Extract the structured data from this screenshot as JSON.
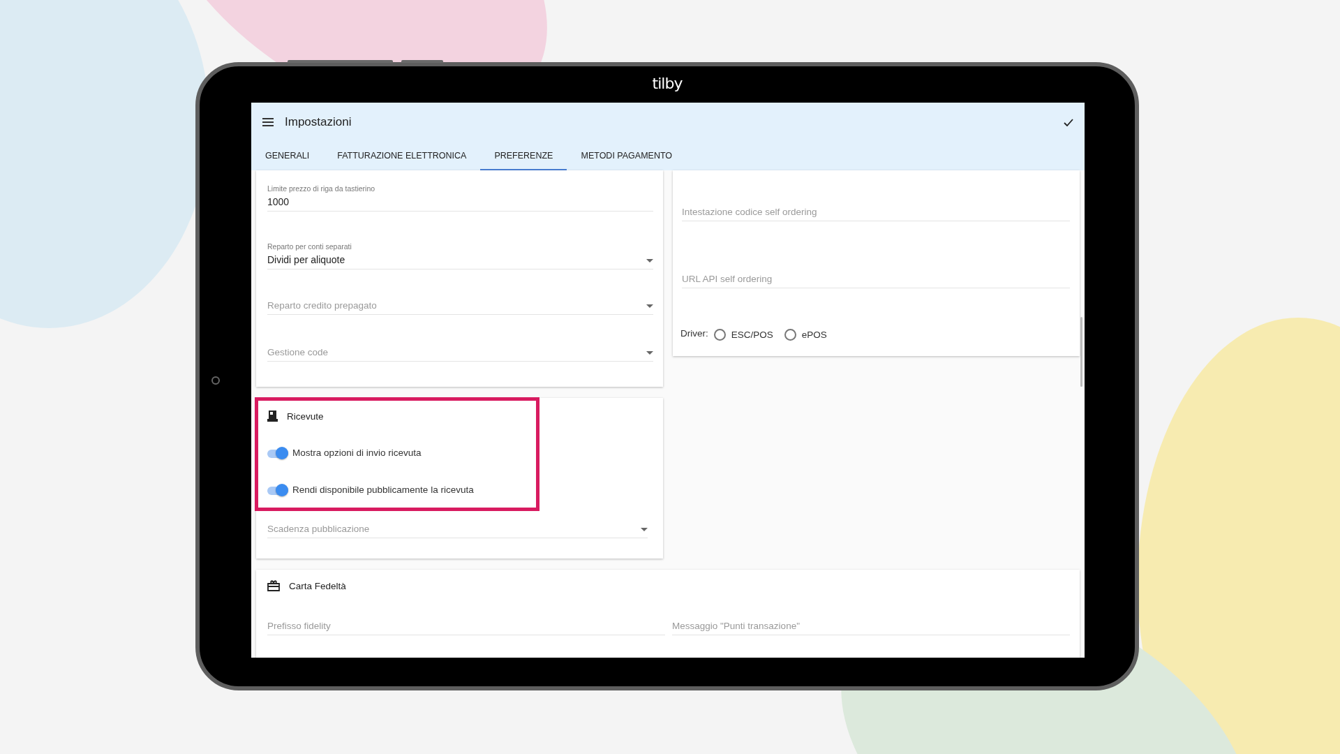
{
  "device": {
    "brand": "tilby"
  },
  "header": {
    "title": "Impostazioni"
  },
  "tabs": [
    {
      "label": "GENERALI",
      "selected": false
    },
    {
      "label": "FATTURAZIONE ELETTRONICA",
      "selected": false
    },
    {
      "label": "PREFERENZE",
      "selected": true
    },
    {
      "label": "METODI PAGAMENTO",
      "selected": false
    }
  ],
  "left_card": {
    "fields": [
      {
        "kind": "input",
        "label": "Limite prezzo di riga da tastierino",
        "value": "1000"
      },
      {
        "kind": "select",
        "label": "Reparto per conti separati",
        "value": "Dividi per aliquote"
      },
      {
        "kind": "select",
        "placeholder": "Reparto credito prepagato"
      },
      {
        "kind": "select",
        "placeholder": "Gestione code"
      }
    ]
  },
  "right_card": {
    "fields": [
      {
        "kind": "input",
        "placeholder": "Intestazione codice self ordering"
      },
      {
        "kind": "input",
        "placeholder": "URL API self ordering"
      }
    ],
    "driver": {
      "label": "Driver:",
      "options": [
        {
          "label": "ESC/POS",
          "selected": false
        },
        {
          "label": "ePOS",
          "selected": false
        }
      ]
    }
  },
  "receipts_card": {
    "title": "Ricevute",
    "highlighted": true,
    "toggles": [
      {
        "label": "Mostra opzioni di invio ricevuta",
        "on": true
      },
      {
        "label": "Rendi disponibile pubblicamente la ricevuta",
        "on": true
      }
    ],
    "fields": [
      {
        "kind": "select",
        "placeholder": "Scadenza pubblicazione"
      }
    ]
  },
  "fidelity_card": {
    "title": "Carta Fedeltà",
    "fields": [
      {
        "kind": "input",
        "placeholder": "Prefisso fidelity"
      },
      {
        "kind": "input",
        "placeholder": "Messaggio \"Punti transazione\""
      }
    ]
  }
}
